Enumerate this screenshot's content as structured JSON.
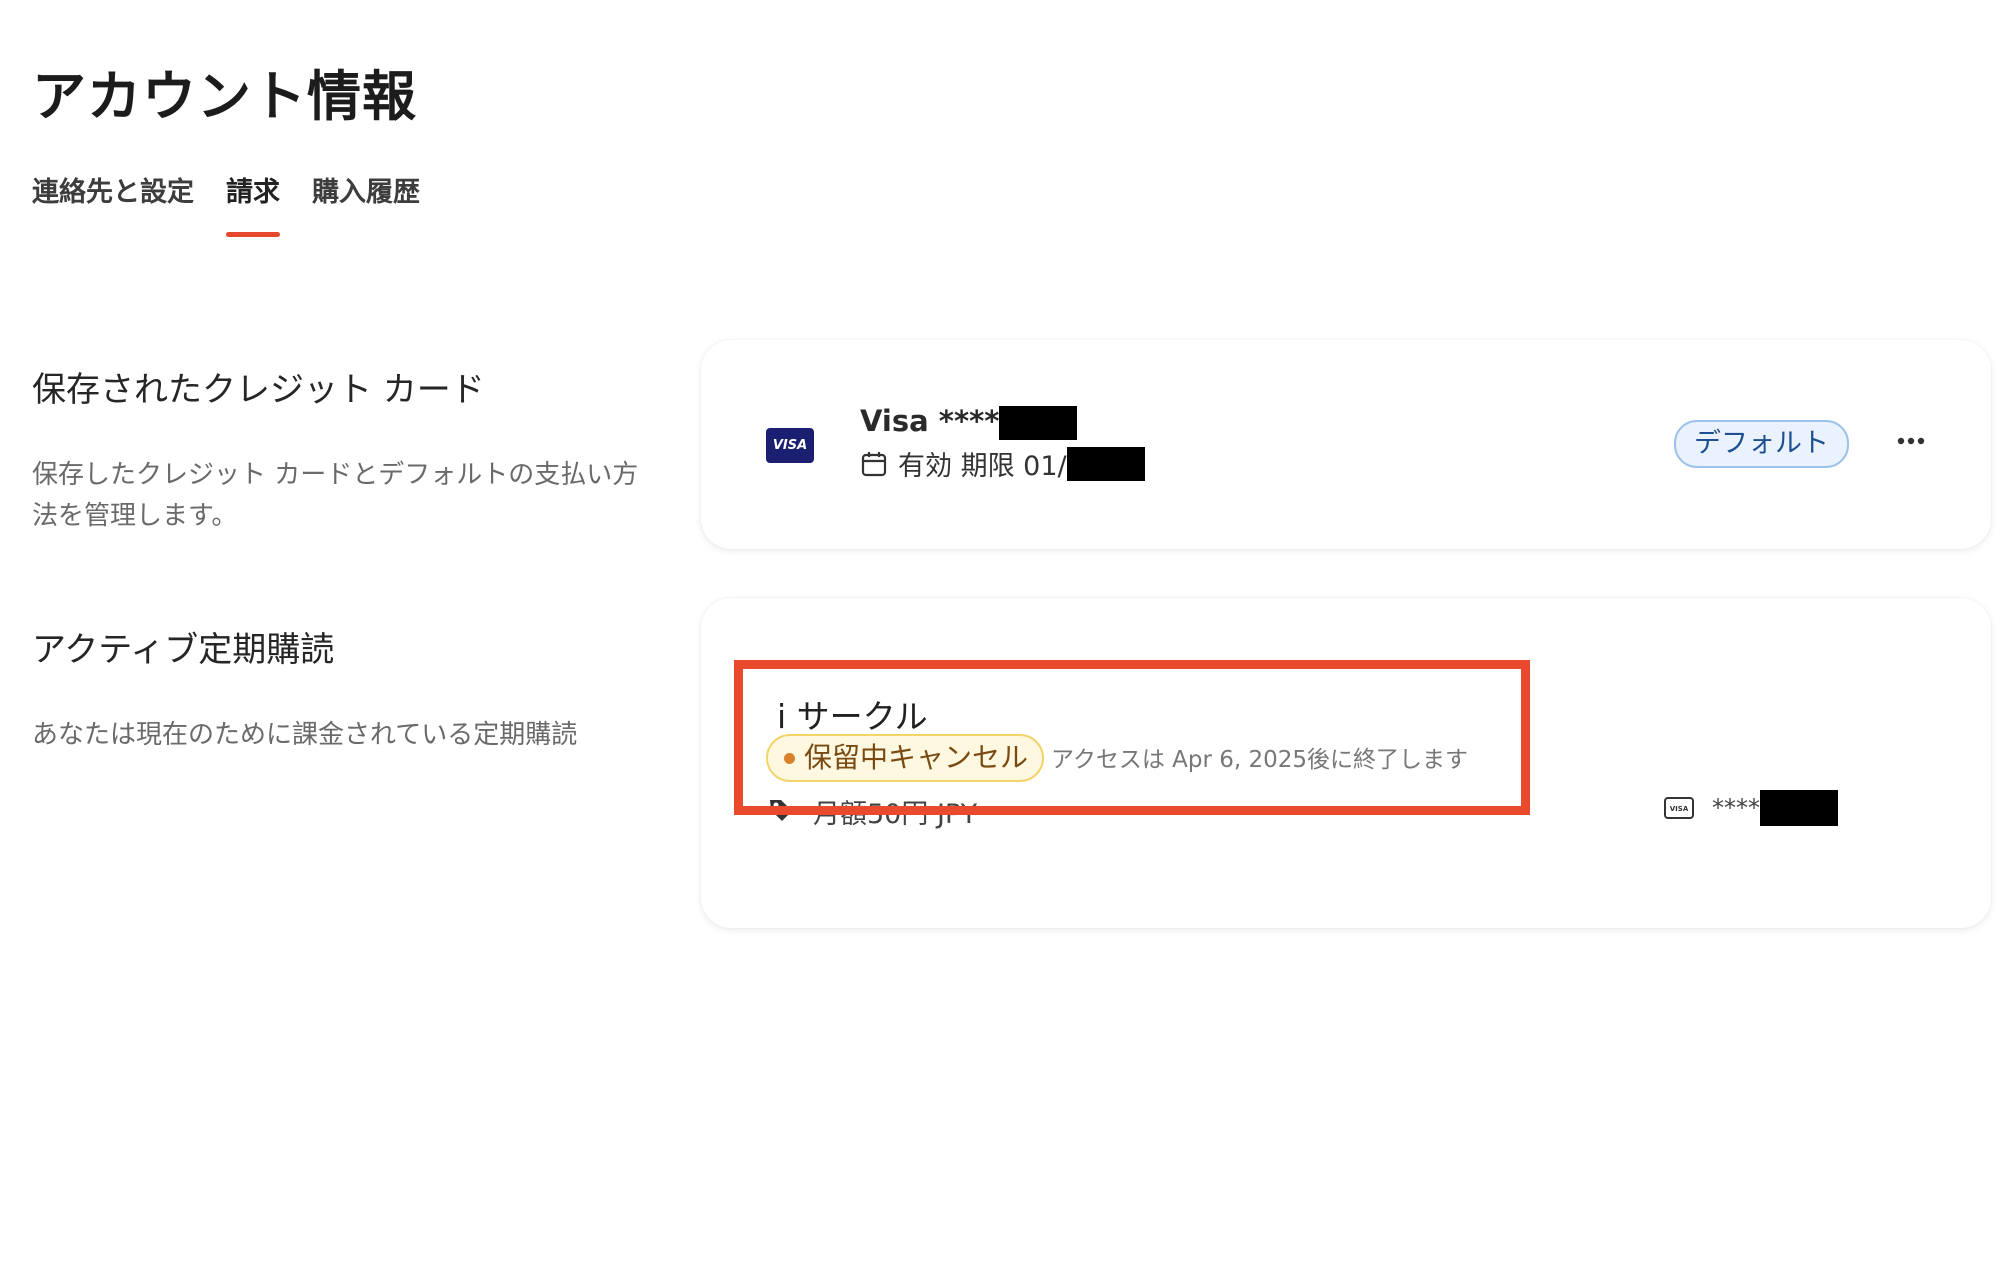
{
  "page": {
    "title": "アカウント情報"
  },
  "tabs": [
    {
      "label": "連絡先と設定",
      "active": false
    },
    {
      "label": "請求",
      "active": true
    },
    {
      "label": "購入履歴",
      "active": false
    }
  ],
  "saved_cards": {
    "title": "保存されたクレジット カード",
    "description": "保存したクレジット カードとデフォルトの支払い方法を管理します。",
    "card": {
      "brand_logo": "VISA",
      "name": "Visa ****",
      "expiry_label": "有効 期限 01/",
      "badge": "デフォルト",
      "more_icon": "more-horizontal-icon"
    }
  },
  "subscriptions": {
    "title": "アクティブ定期購読",
    "description": "あなたは現在のために課金されている定期購読",
    "item": {
      "name": "i サークル",
      "status": "保留中キャンセル",
      "access_note": "アクセスは Apr 6, 2025後に終了します",
      "price": "月額50円 JPY",
      "card_digits": "****",
      "mini_card_logo": "VISA"
    }
  },
  "colors": {
    "accent": "#e7472c",
    "badge_default_bg": "#eaf3fd",
    "badge_pending_bg": "#fff8e0",
    "highlight": "#e94a2e"
  }
}
